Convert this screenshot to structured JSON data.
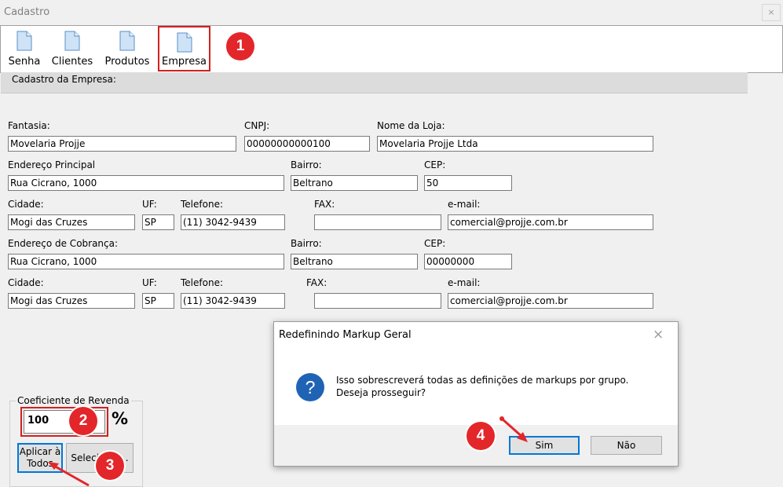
{
  "window": {
    "title": "Cadastro",
    "close_glyph": "×"
  },
  "toolbar": {
    "items": [
      {
        "label": "Senha",
        "icon": "document-icon"
      },
      {
        "label": "Clientes",
        "icon": "document-icon"
      },
      {
        "label": "Produtos",
        "icon": "document-icon"
      },
      {
        "label": "Empresa",
        "icon": "document-icon",
        "highlighted": true
      }
    ]
  },
  "section": {
    "title": "Cadastro da Empresa:"
  },
  "form": {
    "fantasia_label": "Fantasia:",
    "fantasia": "Movelaria Projje",
    "cnpj_label": "CNPJ:",
    "cnpj": "00000000000100",
    "nome_loja_label": "Nome da Loja:",
    "nome_loja": "Movelaria Projje Ltda",
    "principal": {
      "endereco_label": "Endereço Principal",
      "endereco": "Rua Cicrano, 1000",
      "bairro_label": "Bairro:",
      "bairro": "Beltrano",
      "cep_label": "CEP:",
      "cep": "50",
      "cidade_label": "Cidade:",
      "cidade": "Mogi das Cruzes",
      "uf_label": "UF:",
      "uf": "SP",
      "telefone_label": "Telefone:",
      "telefone": "(11) 3042-9439",
      "fax_label": "FAX:",
      "fax": "",
      "email_label": "e-mail:",
      "email": "comercial@projje.com.br"
    },
    "cobranca": {
      "endereco_label": "Endereço de Cobrança:",
      "endereco": "Rua Cicrano, 1000",
      "bairro_label": "Bairro:",
      "bairro": "Beltrano",
      "cep_label": "CEP:",
      "cep": "00000000",
      "cidade_label": "Cidade:",
      "cidade": "Mogi das Cruzes",
      "uf_label": "UF:",
      "uf": "SP",
      "telefone_label": "Telefone:",
      "telefone": "(11) 3042-9439",
      "fax_label": "FAX:",
      "fax": "",
      "email_label": "e-mail:",
      "email": "comercial@projje.com.br"
    }
  },
  "coeficiente": {
    "group_title": "Coeficiente de Revenda",
    "value": "100",
    "unit": "%",
    "apply_button": "Aplicar à Todos",
    "select_button": "Selecionar..."
  },
  "dialog": {
    "title": "Redefinindo Markup Geral",
    "close_glyph": "×",
    "icon": "question-icon",
    "icon_glyph": "?",
    "message_line1": "Isso sobrescreverá todas as definições de markups por grupo.",
    "message_line2": "Deseja prosseguir?",
    "yes_button": "Sim",
    "no_button": "Não"
  },
  "annotations": {
    "badge1": "1",
    "badge2": "2",
    "badge3": "3",
    "badge4": "4",
    "highlight_color": "#d32020",
    "badge_color": "#e3262a"
  },
  "colors": {
    "accent": "#0078d7",
    "dialog_icon": "#1f63b5"
  }
}
